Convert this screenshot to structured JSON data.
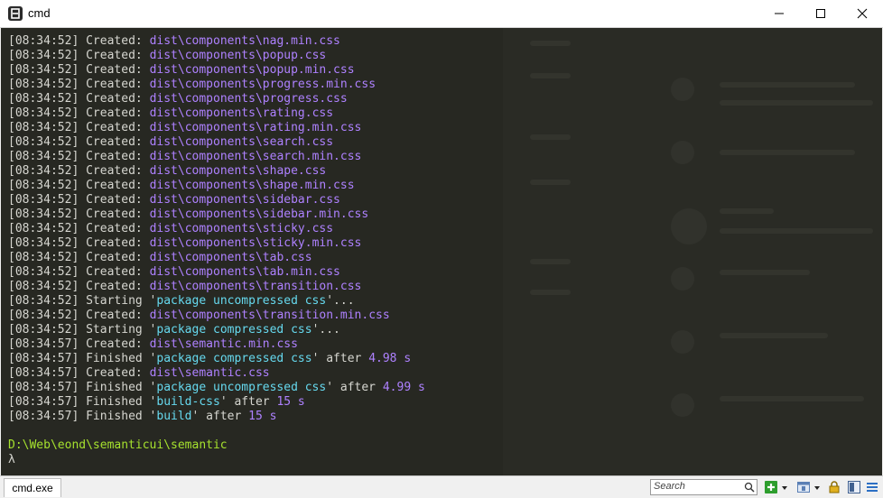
{
  "window": {
    "title": "cmd",
    "controls": {
      "minimize": "minimize-icon",
      "maximize": "maximize-icon",
      "close": "close-icon"
    }
  },
  "terminal": {
    "lines": [
      {
        "ts": "[08:34:52]",
        "action": " Created: ",
        "path": "dist\\components\\nag.min.css"
      },
      {
        "ts": "[08:34:52]",
        "action": " Created: ",
        "path": "dist\\components\\popup.css"
      },
      {
        "ts": "[08:34:52]",
        "action": " Created: ",
        "path": "dist\\components\\popup.min.css"
      },
      {
        "ts": "[08:34:52]",
        "action": " Created: ",
        "path": "dist\\components\\progress.min.css"
      },
      {
        "ts": "[08:34:52]",
        "action": " Created: ",
        "path": "dist\\components\\progress.css"
      },
      {
        "ts": "[08:34:52]",
        "action": " Created: ",
        "path": "dist\\components\\rating.css"
      },
      {
        "ts": "[08:34:52]",
        "action": " Created: ",
        "path": "dist\\components\\rating.min.css"
      },
      {
        "ts": "[08:34:52]",
        "action": " Created: ",
        "path": "dist\\components\\search.css"
      },
      {
        "ts": "[08:34:52]",
        "action": " Created: ",
        "path": "dist\\components\\search.min.css"
      },
      {
        "ts": "[08:34:52]",
        "action": " Created: ",
        "path": "dist\\components\\shape.css"
      },
      {
        "ts": "[08:34:52]",
        "action": " Created: ",
        "path": "dist\\components\\shape.min.css"
      },
      {
        "ts": "[08:34:52]",
        "action": " Created: ",
        "path": "dist\\components\\sidebar.css"
      },
      {
        "ts": "[08:34:52]",
        "action": " Created: ",
        "path": "dist\\components\\sidebar.min.css"
      },
      {
        "ts": "[08:34:52]",
        "action": " Created: ",
        "path": "dist\\components\\sticky.css"
      },
      {
        "ts": "[08:34:52]",
        "action": " Created: ",
        "path": "dist\\components\\sticky.min.css"
      },
      {
        "ts": "[08:34:52]",
        "action": " Created: ",
        "path": "dist\\components\\tab.css"
      },
      {
        "ts": "[08:34:52]",
        "action": " Created: ",
        "path": "dist\\components\\tab.min.css"
      },
      {
        "ts": "[08:34:52]",
        "action": " Created: ",
        "path": "dist\\components\\transition.css"
      },
      {
        "ts": "[08:34:52]",
        "action": " Starting '",
        "quoted": "package uncompressed css",
        "tail": "'..."
      },
      {
        "ts": "[08:34:52]",
        "action": " Created: ",
        "path": "dist\\components\\transition.min.css"
      },
      {
        "ts": "[08:34:52]",
        "action": " Starting '",
        "quoted": "package compressed css",
        "tail": "'..."
      },
      {
        "ts": "[08:34:57]",
        "action": " Created: ",
        "path": "dist\\semantic.min.css"
      },
      {
        "ts": "[08:34:57]",
        "action": " Finished '",
        "quoted": "package compressed css",
        "tail": "' after ",
        "num": "4.98 s"
      },
      {
        "ts": "[08:34:57]",
        "action": " Created: ",
        "path": "dist\\semantic.css"
      },
      {
        "ts": "[08:34:57]",
        "action": " Finished '",
        "quoted": "package uncompressed css",
        "tail": "' after ",
        "num": "4.99 s"
      },
      {
        "ts": "[08:34:57]",
        "action": " Finished '",
        "quoted": "build-css",
        "tail": "' after ",
        "num": "15 s"
      },
      {
        "ts": "[08:34:57]",
        "action": " Finished '",
        "quoted": "build",
        "tail": "' after ",
        "num": "15 s"
      }
    ],
    "prompt_path": "D:\\Web\\eond\\semanticui\\semantic",
    "prompt_symbol": "λ"
  },
  "statusbar": {
    "tab_label": "cmd.exe",
    "search_placeholder": "Search",
    "icons": [
      "search-icon",
      "add-tab-icon",
      "dropdown-icon",
      "window-view-icon",
      "dropdown-icon",
      "lock-icon",
      "split-view-icon",
      "menu-icon"
    ]
  },
  "colors": {
    "background": "#272822",
    "path": "#ae81ff",
    "quoted": "#66d9ef",
    "prompt": "#a6e22e",
    "text": "#d6d6d0"
  }
}
